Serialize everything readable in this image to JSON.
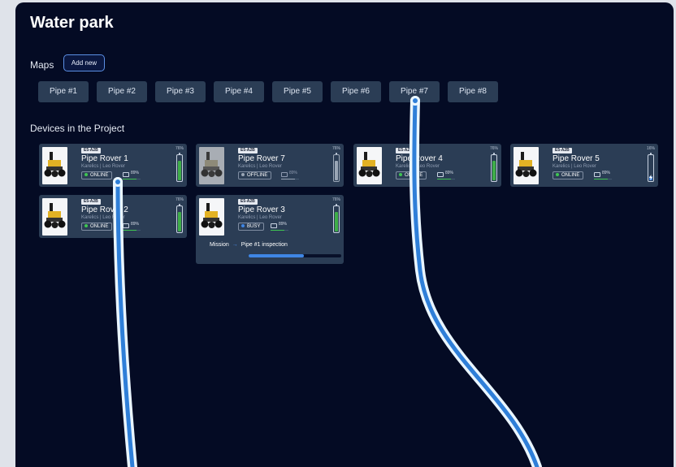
{
  "page": {
    "title": "Water park"
  },
  "maps": {
    "label": "Maps",
    "add_button": "Add new",
    "tabs": [
      "Pipe #1",
      "Pipe #2",
      "Pipe #3",
      "Pipe #4",
      "Pipe #5",
      "Pipe #6",
      "Pipe #7",
      "Pipe #8"
    ]
  },
  "devices": {
    "section_title": "Devices in the Project",
    "items": [
      {
        "chip": "E5-A2B",
        "name": "Pipe Rover 1",
        "sub": "Karelics | Leo Rover",
        "status": "ONLINE",
        "status_color": "#3fc552",
        "battery_text": "89%",
        "signal": 0.75,
        "battery_pct": "76%",
        "battery_level": 0.76,
        "battery_color": "#3fae49"
      },
      {
        "chip": "E5-A2B",
        "name": "Pipe Rover 7",
        "sub": "Karelics | Leo Rover",
        "status": "OFFLINE",
        "status_color": "#9aa6b6",
        "battery_text": "89%",
        "signal": 0.75,
        "battery_pct": "76%",
        "battery_level": 0.76,
        "battery_color": "#9aa6b6"
      },
      {
        "chip": "E5-A2B",
        "name": "Pipe Rover 4",
        "sub": "Karelics | Leo Rover",
        "status": "ONLINE",
        "status_color": "#3fc552",
        "battery_text": "89%",
        "signal": 0.75,
        "battery_pct": "76%",
        "battery_level": 0.76,
        "battery_color": "#3fae49"
      },
      {
        "chip": "E5-A2B",
        "name": "Pipe Rover 5",
        "sub": "Karelics | Leo Rover",
        "status": "ONLINE",
        "status_color": "#3fc552",
        "battery_text": "89%",
        "signal": 0.75,
        "battery_pct": "16%",
        "battery_level": 0.16,
        "battery_color": "#3f86e4"
      },
      {
        "chip": "E5-A2B",
        "name": "Pipe Rover 2",
        "sub": "Karelics | Leo Rover",
        "status": "ONLINE",
        "status_color": "#3fc552",
        "battery_text": "89%",
        "signal": 0.75,
        "battery_pct": "76%",
        "battery_level": 0.76,
        "battery_color": "#3fae49"
      },
      {
        "chip": "E5-A2B",
        "name": "Pipe Rover 3",
        "sub": "Karelics | Leo Rover",
        "status": "BUSY",
        "status_color": "#3f86e4",
        "battery_text": "89%",
        "signal": 0.75,
        "battery_pct": "76%",
        "battery_level": 0.76,
        "battery_color": "#3fae49",
        "mission": {
          "label": "Mission",
          "target": "Pipe #1 inspection",
          "progress": 0.6
        }
      }
    ]
  },
  "colors": {
    "background": "#040b24",
    "card": "#2b3d55",
    "accent": "#3f86e4",
    "online": "#3fc552"
  }
}
